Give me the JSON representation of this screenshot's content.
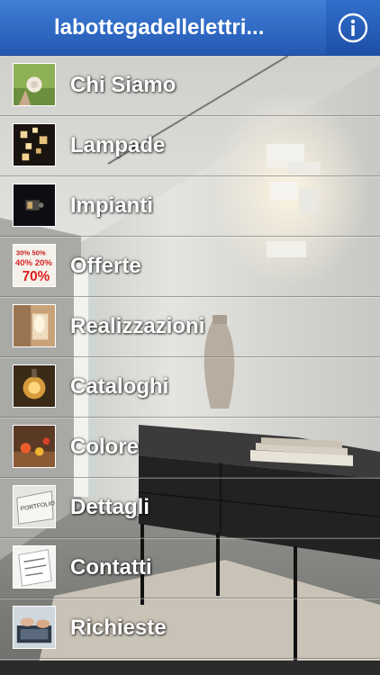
{
  "header": {
    "title": "labottegadellelettri...",
    "info_icon": "info-circle-icon"
  },
  "menu": {
    "items": [
      {
        "label": "Chi Siamo",
        "icon": "chi-siamo-thumbnail"
      },
      {
        "label": "Lampade",
        "icon": "lampade-thumbnail"
      },
      {
        "label": "Impianti",
        "icon": "impianti-thumbnail"
      },
      {
        "label": "Offerte",
        "icon": "offerte-thumbnail"
      },
      {
        "label": "Realizzazioni",
        "icon": "realizzazioni-thumbnail"
      },
      {
        "label": "Cataloghi",
        "icon": "cataloghi-thumbnail"
      },
      {
        "label": "Colore",
        "icon": "colore-thumbnail"
      },
      {
        "label": "Dettagli",
        "icon": "dettagli-thumbnail"
      },
      {
        "label": "Contatti",
        "icon": "contatti-thumbnail"
      },
      {
        "label": "Richieste",
        "icon": "richieste-thumbnail"
      }
    ]
  },
  "thumb_offerte_text": {
    "line1": "30% 50%",
    "line2": "40% 20%",
    "line3": "70%"
  },
  "thumb_dettagli_text": "PORTFOLIO",
  "colors": {
    "header_top": "#3f7fd6",
    "header_bottom": "#2358b3",
    "label_text": "#ffffff"
  }
}
